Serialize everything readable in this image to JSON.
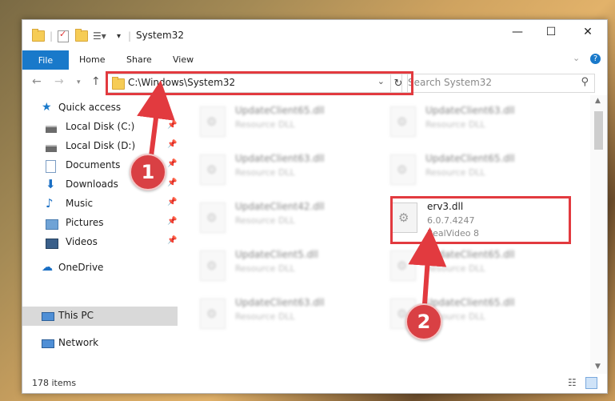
{
  "window": {
    "title": "System32",
    "controls": {
      "minimize": "—",
      "maximize": "☐",
      "close": "✕"
    }
  },
  "ribbon": {
    "tabs": [
      "File",
      "Home",
      "Share",
      "View"
    ],
    "help": "?"
  },
  "address": {
    "path": "C:\\Windows\\System32",
    "search_placeholder": "Search System32"
  },
  "nav": {
    "items": [
      {
        "label": "Quick access",
        "icon": "star-icon"
      },
      {
        "label": "Local Disk (C:)",
        "icon": "drive-icon"
      },
      {
        "label": "Local Disk (D:)",
        "icon": "drive-icon"
      },
      {
        "label": "Documents",
        "icon": "documents-icon"
      },
      {
        "label": "Downloads",
        "icon": "download-icon"
      },
      {
        "label": "Music",
        "icon": "music-icon"
      },
      {
        "label": "Pictures",
        "icon": "pictures-icon"
      },
      {
        "label": "Videos",
        "icon": "videos-icon"
      },
      {
        "label": "OneDrive",
        "icon": "cloud-icon"
      },
      {
        "label": "This PC",
        "icon": "monitor-icon"
      },
      {
        "label": "Network",
        "icon": "network-icon"
      }
    ]
  },
  "files": {
    "col1": [
      {
        "name": "UpdateClient65.dll",
        "sub": "Resource DLL"
      },
      {
        "name": "UpdateClient63.dll",
        "sub": "Resource DLL"
      },
      {
        "name": "UpdateClient42.dll",
        "sub": "Resource DLL"
      },
      {
        "name": "UpdateClient5.dll",
        "sub": "Resource DLL"
      },
      {
        "name": "UpdateClient63.dll",
        "sub": "Resource DLL"
      }
    ],
    "col2": [
      {
        "name": "UpdateClient63.dll",
        "sub": "Resource DLL"
      },
      {
        "name": "UpdateClient65.dll",
        "sub": "Resource DLL"
      },
      {
        "name": "UpdateClient65.dll",
        "sub": "Resource DLL"
      },
      {
        "name": "UpdateClient65.dll",
        "sub": "Resource DLL"
      }
    ],
    "highlighted": {
      "name": "erv3.dll",
      "version": "6.0.7.4247",
      "product": "RealVideo 8"
    }
  },
  "status": {
    "count": "178 items"
  },
  "callouts": {
    "one": "1",
    "two": "2"
  },
  "colors": {
    "accent": "#1979ca",
    "annotation": "#e23a3f"
  }
}
